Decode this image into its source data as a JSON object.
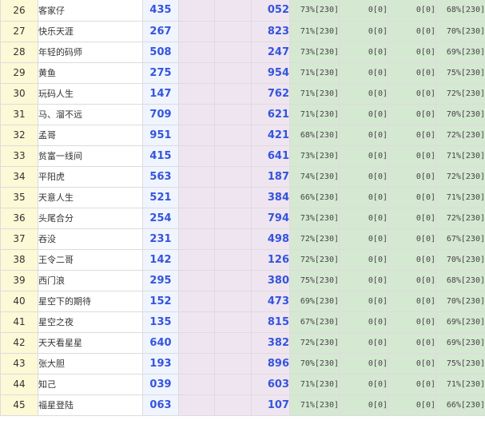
{
  "rows": [
    {
      "no": "26",
      "name": "客家仔",
      "a": "435",
      "b": "052",
      "p1": "73%[230]",
      "z1": "0[0]",
      "z2": "0[0]",
      "p2": "68%[230]"
    },
    {
      "no": "27",
      "name": "快乐天涯",
      "a": "267",
      "b": "823",
      "p1": "71%[230]",
      "z1": "0[0]",
      "z2": "0[0]",
      "p2": "70%[230]"
    },
    {
      "no": "28",
      "name": "年轻的码师",
      "a": "508",
      "b": "247",
      "p1": "73%[230]",
      "z1": "0[0]",
      "z2": "0[0]",
      "p2": "69%[230]"
    },
    {
      "no": "29",
      "name": "黄鱼",
      "a": "275",
      "b": "954",
      "p1": "71%[230]",
      "z1": "0[0]",
      "z2": "0[0]",
      "p2": "75%[230]"
    },
    {
      "no": "30",
      "name": "玩码人生",
      "a": "147",
      "b": "762",
      "p1": "71%[230]",
      "z1": "0[0]",
      "z2": "0[0]",
      "p2": "72%[230]"
    },
    {
      "no": "31",
      "name": "马、溜不远",
      "a": "709",
      "b": "621",
      "p1": "71%[230]",
      "z1": "0[0]",
      "z2": "0[0]",
      "p2": "70%[230]"
    },
    {
      "no": "32",
      "name": "孟哥",
      "a": "951",
      "b": "421",
      "p1": "68%[230]",
      "z1": "0[0]",
      "z2": "0[0]",
      "p2": "72%[230]"
    },
    {
      "no": "33",
      "name": "贫富一线间",
      "a": "415",
      "b": "641",
      "p1": "73%[230]",
      "z1": "0[0]",
      "z2": "0[0]",
      "p2": "71%[230]"
    },
    {
      "no": "34",
      "name": "平阳虎",
      "a": "563",
      "b": "187",
      "p1": "74%[230]",
      "z1": "0[0]",
      "z2": "0[0]",
      "p2": "72%[230]"
    },
    {
      "no": "35",
      "name": "天意人生",
      "a": "521",
      "b": "384",
      "p1": "66%[230]",
      "z1": "0[0]",
      "z2": "0[0]",
      "p2": "71%[230]"
    },
    {
      "no": "36",
      "name": "头尾合分",
      "a": "254",
      "b": "794",
      "p1": "73%[230]",
      "z1": "0[0]",
      "z2": "0[0]",
      "p2": "72%[230]"
    },
    {
      "no": "37",
      "name": "吞没",
      "a": "231",
      "b": "498",
      "p1": "72%[230]",
      "z1": "0[0]",
      "z2": "0[0]",
      "p2": "67%[230]"
    },
    {
      "no": "38",
      "name": "王令二哥",
      "a": "142",
      "b": "126",
      "p1": "72%[230]",
      "z1": "0[0]",
      "z2": "0[0]",
      "p2": "70%[230]"
    },
    {
      "no": "39",
      "name": "西门浪",
      "a": "295",
      "b": "380",
      "p1": "75%[230]",
      "z1": "0[0]",
      "z2": "0[0]",
      "p2": "68%[230]"
    },
    {
      "no": "40",
      "name": "星空下的期待",
      "a": "152",
      "b": "473",
      "p1": "69%[230]",
      "z1": "0[0]",
      "z2": "0[0]",
      "p2": "70%[230]"
    },
    {
      "no": "41",
      "name": "星空之夜",
      "a": "135",
      "b": "815",
      "p1": "67%[230]",
      "z1": "0[0]",
      "z2": "0[0]",
      "p2": "69%[230]"
    },
    {
      "no": "42",
      "name": "天天看星星",
      "a": "640",
      "b": "382",
      "p1": "72%[230]",
      "z1": "0[0]",
      "z2": "0[0]",
      "p2": "69%[230]"
    },
    {
      "no": "43",
      "name": "张大胆",
      "a": "193",
      "b": "896",
      "p1": "70%[230]",
      "z1": "0[0]",
      "z2": "0[0]",
      "p2": "75%[230]"
    },
    {
      "no": "44",
      "name": "知己",
      "a": "039",
      "b": "603",
      "p1": "71%[230]",
      "z1": "0[0]",
      "z2": "0[0]",
      "p2": "71%[230]"
    },
    {
      "no": "45",
      "name": "福星登陆",
      "a": "063",
      "b": "107",
      "p1": "71%[230]",
      "z1": "0[0]",
      "z2": "0[0]",
      "p2": "66%[230]"
    }
  ]
}
